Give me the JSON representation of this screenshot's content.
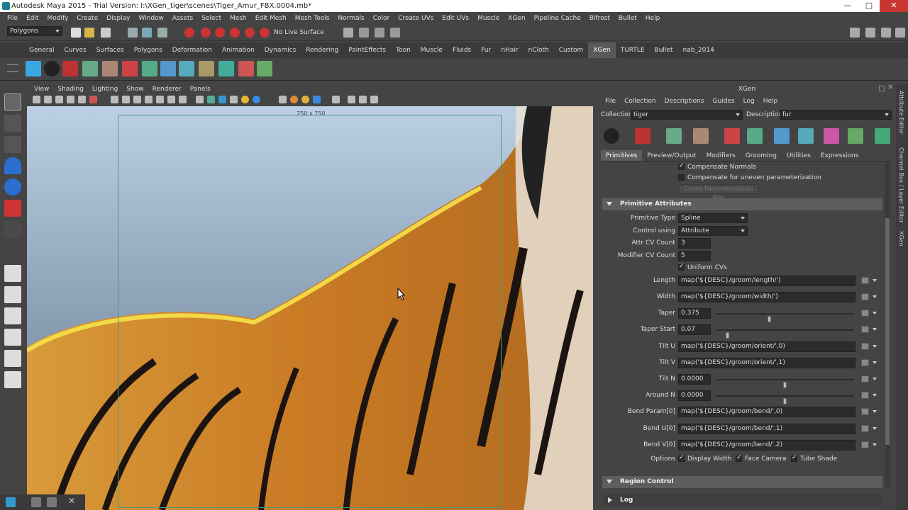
{
  "window": {
    "title": "Autodesk Maya 2015 - Trial Version: I:\\XGen_tiger\\scenes\\Tiger_Amur_FBX.0004.mb*",
    "minimize": "—",
    "maximize": "□",
    "close": "✕"
  },
  "menubar": [
    "File",
    "Edit",
    "Modify",
    "Create",
    "Display",
    "Window",
    "Assets",
    "Select",
    "Mesh",
    "Edit Mesh",
    "Mesh Tools",
    "Normals",
    "Color",
    "Create UVs",
    "Edit UVs",
    "Muscle",
    "XGen",
    "Pipeline Cache",
    "Bifrost",
    "Bullet",
    "Help"
  ],
  "statusline": {
    "menuset": "Polygons",
    "live_surface": "No Live Surface"
  },
  "shelf_tabs": [
    "General",
    "Curves",
    "Surfaces",
    "Polygons",
    "Deformation",
    "Animation",
    "Dynamics",
    "Rendering",
    "PaintEffects",
    "Toon",
    "Muscle",
    "Fluids",
    "Fur",
    "nHair",
    "nCloth",
    "Custom",
    "XGen",
    "TURTLE",
    "Bullet",
    "nab_2014"
  ],
  "shelf_active": "XGen",
  "viewport": {
    "menu": [
      "View",
      "Shading",
      "Lighting",
      "Show",
      "Renderer",
      "Panels"
    ],
    "resolution_label": "750 x 750"
  },
  "xgen": {
    "title": "XGen",
    "menu": [
      "File",
      "Collection",
      "Descriptions",
      "Guides",
      "Log",
      "Help"
    ],
    "collection_label": "Collection",
    "collection_value": "tiger",
    "description_label": "Description",
    "description_value": "fur",
    "tabs": [
      "Primitives",
      "Preview/Output",
      "Modifiers",
      "Grooming",
      "Utilities",
      "Expressions"
    ],
    "active_tab": "Primitives",
    "compensate_normals": "Compensate Normals",
    "compensate_uneven": "Compensate for uneven parameterization",
    "create_param_map": "Create Parameterization Map",
    "primitive_section": "Primitive Attributes",
    "primitive_type_label": "Primitive Type",
    "primitive_type_value": "Spline",
    "control_using_label": "Control using",
    "control_using_value": "Attribute",
    "attr_cv_label": "Attr CV Count",
    "attr_cv_value": "3",
    "modifier_cv_label": "Modifier CV Count",
    "modifier_cv_value": "5",
    "uniform_cvs": "Uniform CVs",
    "length_label": "Length",
    "length_value": "map('${DESC}/groom/length/')",
    "width_label": "Width",
    "width_value": "map('${DESC}/groom/width/')",
    "taper_label": "Taper",
    "taper_value": "0.375",
    "taper_fraction": 0.375,
    "taper_start_label": "Taper Start",
    "taper_start_value": "0.07",
    "taper_start_fraction": 0.07,
    "tilt_u_label": "Tilt U",
    "tilt_u_value": "map('${DESC}/groom/orient/',0)",
    "tilt_v_label": "Tilt V",
    "tilt_v_value": "map('${DESC}/groom/orient/',1)",
    "tilt_n_label": "Tilt N",
    "tilt_n_value": "0.0000",
    "around_n_label": "Around N",
    "around_n_value": "0.0000",
    "bend_param_label": "Bend Param[0]",
    "bend_param_value": "map('${DESC}/groom/bend/',0)",
    "bend_u_label": "Bend U[0]",
    "bend_u_value": "map('${DESC}/groom/bend/',1)",
    "bend_v_label": "Bend V[0]",
    "bend_v_value": "map('${DESC}/groom/bend/',2)",
    "options_label": "Options",
    "display_width": "Display Width",
    "face_camera": "Face Camera",
    "tube_shade": "Tube Shade",
    "region_section": "Region Control",
    "log_section": "Log"
  },
  "side_tabs": [
    "Attribute Editor",
    "Channel Box / Layer Editor",
    "XGen"
  ]
}
